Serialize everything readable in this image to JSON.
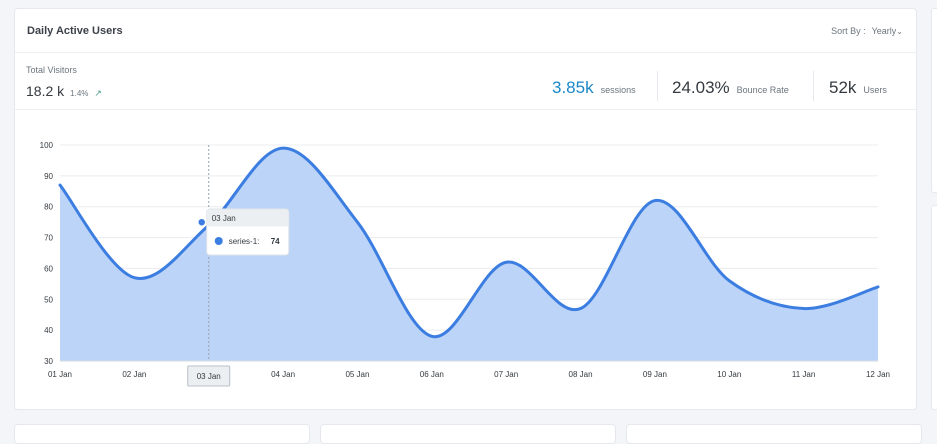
{
  "card": {
    "title": "Daily Active Users",
    "sort_label": "Sort By :",
    "sort_value": "Yearly",
    "sort_icon": "chevron-down-icon"
  },
  "stats": {
    "total_label": "Total Visitors",
    "total_value": "18.2 k",
    "total_change": "1.4%",
    "total_change_icon": "arrow-up-right-icon",
    "sessions_value": "3.85k",
    "sessions_label": "sessions",
    "bounce_value": "24.03%",
    "bounce_label": "Bounce Rate",
    "users_value": "52k",
    "users_label": "Users"
  },
  "colors": {
    "series_line": "#3b7de0",
    "series_fill": "#bcd4f8",
    "sessions_accent": "#1b88c9",
    "grid": "#e9ecef"
  },
  "chart_data": {
    "type": "area",
    "x": [
      "01 Jan",
      "02 Jan",
      "03 Jan",
      "04 Jan",
      "05 Jan",
      "06 Jan",
      "07 Jan",
      "08 Jan",
      "09 Jan",
      "10 Jan",
      "11 Jan",
      "12 Jan"
    ],
    "series": [
      {
        "name": "series-1",
        "values": [
          87,
          57,
          74,
          99,
          75,
          38,
          62,
          47,
          82,
          56,
          47,
          54
        ]
      }
    ],
    "ylim": [
      30,
      100
    ],
    "yticks": [
      30,
      40,
      50,
      60,
      70,
      80,
      90,
      100
    ],
    "grid": true,
    "tooltip": {
      "x": "03 Jan",
      "series": "series-1",
      "label": "series-1:",
      "value": "74"
    },
    "crosshair_label": "03 Jan"
  }
}
